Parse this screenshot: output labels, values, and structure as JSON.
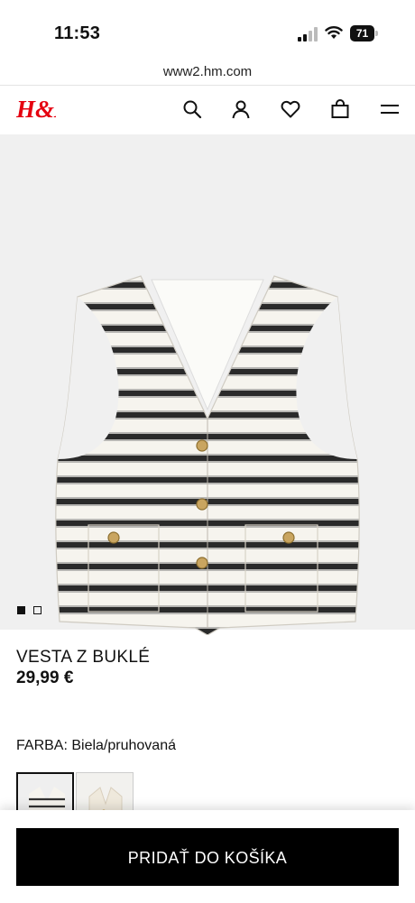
{
  "status_bar": {
    "time": "11:53",
    "battery": "71"
  },
  "browser": {
    "url": "www2.hm.com"
  },
  "header": {
    "logo_text": "H&M",
    "icons": [
      "search-icon",
      "account-icon",
      "favorites-icon",
      "bag-icon",
      "menu-icon"
    ],
    "brand_color": "#e50010"
  },
  "gallery": {
    "image_count": 2,
    "active_index": 0
  },
  "product": {
    "name": "VESTA Z BUKLÉ",
    "price": "29,99 €",
    "color_label": "FARBA: Biela/pruhovaná"
  },
  "swatches": [
    {
      "name": "Biela/pruhovaná",
      "selected": true
    },
    {
      "name": "Krémová",
      "selected": false
    }
  ],
  "cta": {
    "label": "PRIDAŤ DO KOŠÍKA"
  }
}
